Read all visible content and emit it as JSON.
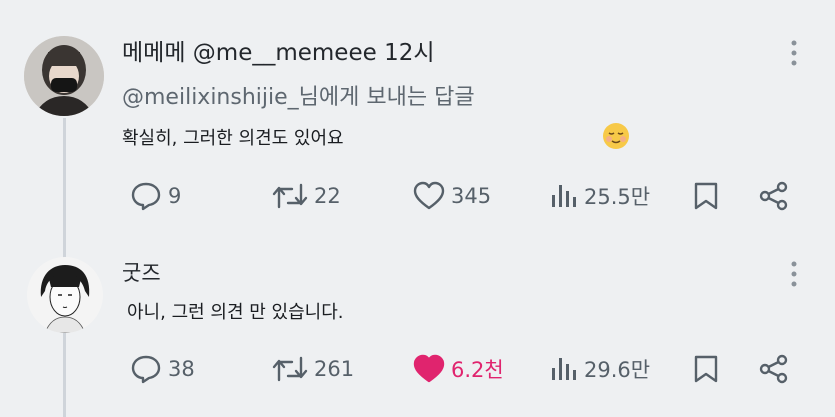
{
  "posts": [
    {
      "display_name": "메메메",
      "handle": "@me__memeee",
      "time": "12시",
      "replying_to": "@meilixinshijie_님에게 보내는 답글",
      "text": "확실히, 그러한 의견도 있어요",
      "emoji": "relieved-face-emoji",
      "metrics": {
        "replies": "9",
        "reposts": "22",
        "likes": "345",
        "views": "25.5만"
      },
      "liked": false
    },
    {
      "display_name": "굿즈",
      "text": "아니, 그런 의견 만 있습니다.",
      "metrics": {
        "replies": "38",
        "reposts": "261",
        "likes": "6.2천",
        "views": "29.6만"
      },
      "liked": true
    }
  ],
  "colors": {
    "like_active": "#e0246e",
    "icon": "#566069",
    "background": "#eef0f2"
  },
  "icons": [
    "reply-icon",
    "repost-icon",
    "like-icon",
    "views-icon",
    "bookmark-icon",
    "share-icon",
    "more-icon"
  ]
}
